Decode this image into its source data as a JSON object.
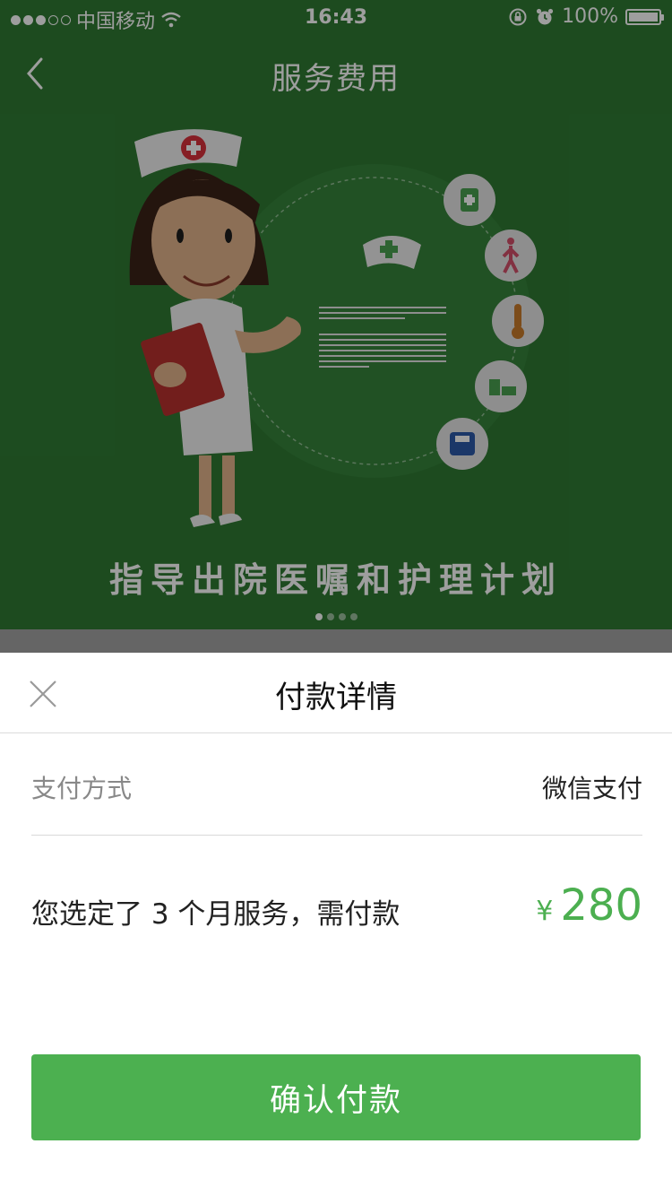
{
  "statusbar": {
    "carrier": "中国移动",
    "time": "16:43",
    "battery": "100%"
  },
  "navbar": {
    "title": "服务费用"
  },
  "banner": {
    "caption": "指导出院医嘱和护理计划",
    "page_count": 4,
    "active_page": 1
  },
  "sheet": {
    "title": "付款详情",
    "pay_method_label": "支付方式",
    "pay_method_value": "微信支付",
    "amount_desc": "您选定了 3 个月服务，需付款",
    "currency": "¥",
    "amount": "280",
    "confirm_label": "确认付款"
  },
  "colors": {
    "accent": "#4cb050",
    "banner_bg": "#2f7a33"
  }
}
